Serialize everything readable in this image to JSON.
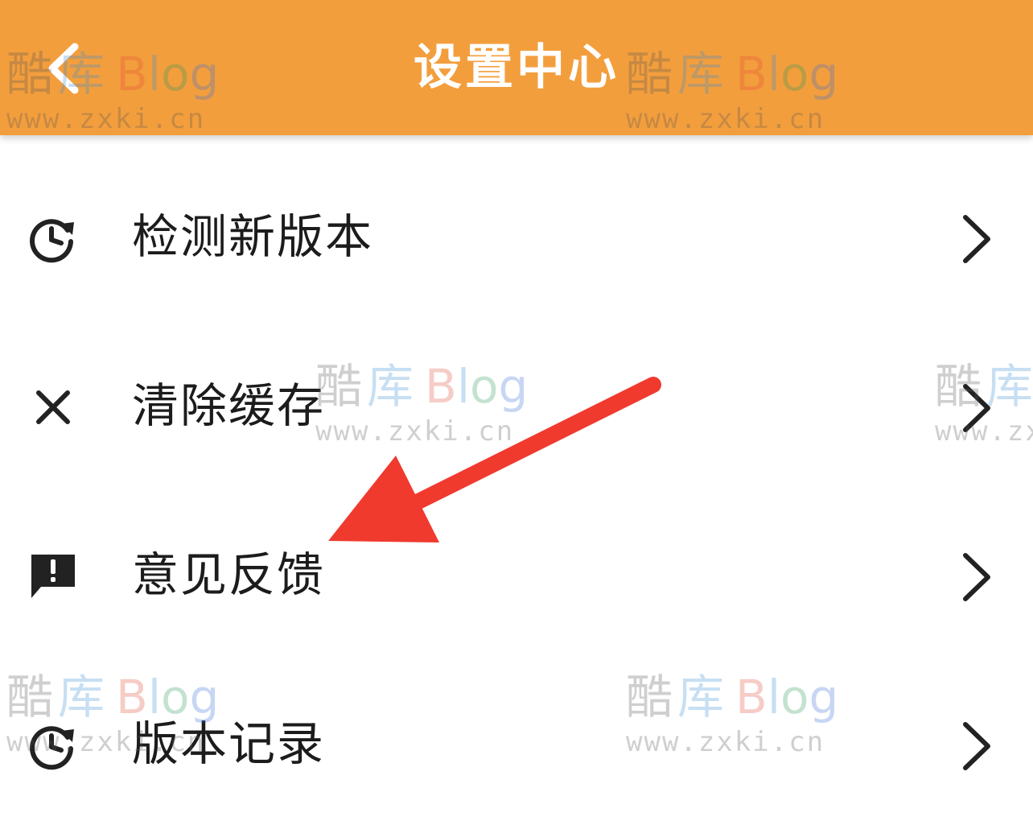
{
  "app_bar": {
    "title": "设置中心",
    "background": "#F39E3D",
    "back_icon": "chevron-left-icon"
  },
  "settings": {
    "items": [
      {
        "label": "检测新版本",
        "icon": "history-refresh-icon"
      },
      {
        "label": "清除缓存",
        "icon": "close-icon"
      },
      {
        "label": "意见反馈",
        "icon": "feedback-alert-icon"
      },
      {
        "label": "版本记录",
        "icon": "history-refresh-icon"
      }
    ],
    "chevron_icon": "chevron-right-icon"
  },
  "watermark": {
    "brand_cn_1": "酷",
    "brand_cn_2": "库",
    "brand_b": "B",
    "brand_l": "l",
    "brand_o": "o",
    "brand_g": "g",
    "url": "www.zxki.cn"
  },
  "annotation": {
    "arrow_color": "#F03A2E",
    "arrow_icon": "red-arrow-icon"
  }
}
